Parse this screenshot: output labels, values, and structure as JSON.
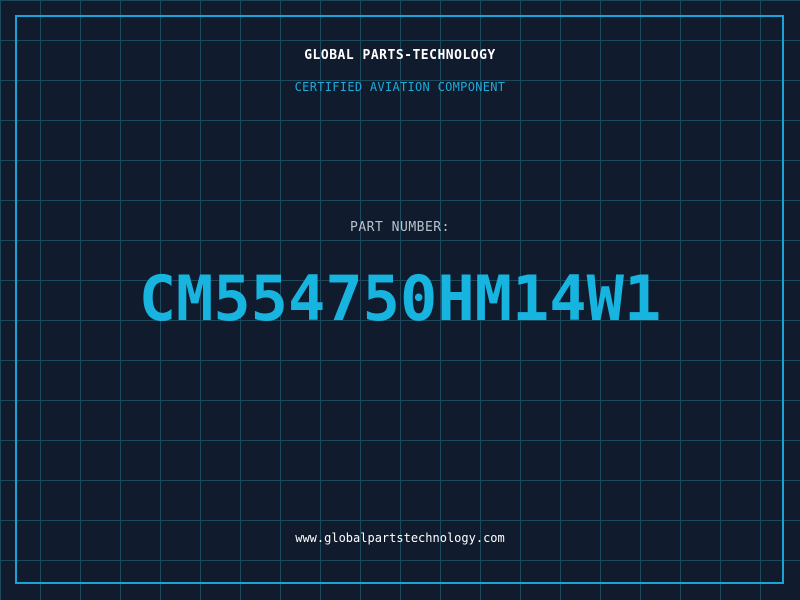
{
  "header": {
    "company": "GLOBAL PARTS-TECHNOLOGY",
    "subtitle": "CERTIFIED AVIATION COMPONENT"
  },
  "part": {
    "label": "PART NUMBER:",
    "number": "CM554750HM14W1"
  },
  "footer": {
    "website": "www.globalpartstechnology.com"
  },
  "colors": {
    "background": "#111b2e",
    "grid": "#1e4a5e",
    "accent": "#1aa3d6",
    "part_number": "#17b4e0"
  }
}
